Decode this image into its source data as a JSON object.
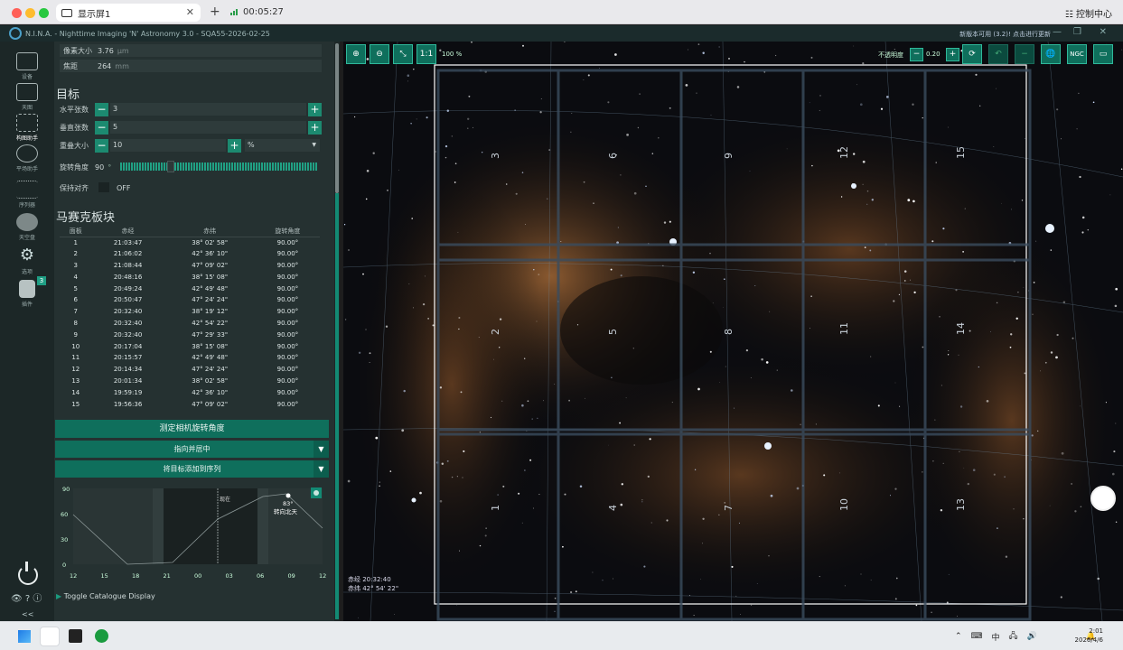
{
  "browser": {
    "tab_title": "显示屏1",
    "timer": "00:05:27",
    "control_center": "控制中心"
  },
  "app": {
    "title": "N.I.N.A. - Nighttime Imaging 'N' Astronomy 3.0  -  SQA55-2026-02-25",
    "update_notice": "新版本可用 (3.2)! 点击进行更新"
  },
  "nav": {
    "items": [
      {
        "label": "设备"
      },
      {
        "label": "天图"
      },
      {
        "label": "构图助手"
      },
      {
        "label": "平场助手"
      },
      {
        "label": "序列器"
      },
      {
        "label": "天空盘"
      },
      {
        "label": "选项"
      },
      {
        "label": "插件",
        "badge": "3"
      }
    ],
    "collapse": "<<"
  },
  "camera": {
    "pixel_size_label": "像素大小",
    "pixel_size_value": "3.76",
    "pixel_size_unit": "μm",
    "focal_label": "焦距",
    "focal_value": "264",
    "focal_unit": "mm"
  },
  "target": {
    "heading": "目标",
    "h_panels_label": "水平张数",
    "h_panels_value": "3",
    "v_panels_label": "垂直张数",
    "v_panels_value": "5",
    "overlap_label": "重叠大小",
    "overlap_value": "10",
    "overlap_unit": "%",
    "rotation_label": "旋转角度",
    "rotation_value": "90",
    "rotation_unit": "°",
    "keep_aligned_label": "保持对齐",
    "keep_aligned_state": "OFF"
  },
  "mosaic": {
    "heading": "马赛克板块",
    "columns": [
      "面板",
      "赤经",
      "赤纬",
      "旋转角度"
    ],
    "rows": [
      [
        "1",
        "21:03:47",
        "38° 02' 58\"",
        "90.00°"
      ],
      [
        "2",
        "21:06:02",
        "42° 36' 10\"",
        "90.00°"
      ],
      [
        "3",
        "21:08:44",
        "47° 09' 02\"",
        "90.00°"
      ],
      [
        "4",
        "20:48:16",
        "38° 15' 08\"",
        "90.00°"
      ],
      [
        "5",
        "20:49:24",
        "42° 49' 48\"",
        "90.00°"
      ],
      [
        "6",
        "20:50:47",
        "47° 24' 24\"",
        "90.00°"
      ],
      [
        "7",
        "20:32:40",
        "38° 19' 12\"",
        "90.00°"
      ],
      [
        "8",
        "20:32:40",
        "42° 54' 22\"",
        "90.00°"
      ],
      [
        "9",
        "20:32:40",
        "47° 29' 33\"",
        "90.00°"
      ],
      [
        "10",
        "20:17:04",
        "38° 15' 08\"",
        "90.00°"
      ],
      [
        "11",
        "20:15:57",
        "42° 49' 48\"",
        "90.00°"
      ],
      [
        "12",
        "20:14:34",
        "47° 24' 24\"",
        "90.00°"
      ],
      [
        "13",
        "20:01:34",
        "38° 02' 58\"",
        "90.00°"
      ],
      [
        "14",
        "19:59:19",
        "42° 36' 10\"",
        "90.00°"
      ],
      [
        "15",
        "19:56:36",
        "47° 09' 02\"",
        "90.00°"
      ]
    ]
  },
  "actions": {
    "measure_rotation": "测定相机旋转角度",
    "slew_center": "指向并居中",
    "add_to_sequence": "将目标添加到序列"
  },
  "altitude_chart": {
    "y_ticks": [
      "90",
      "60",
      "30",
      "0"
    ],
    "x_ticks": [
      "12",
      "15",
      "18",
      "21",
      "00",
      "03",
      "06",
      "09",
      "12"
    ],
    "now_label": "现在",
    "max_alt": "83°",
    "transit_label": "转向北天"
  },
  "catalogue": {
    "toggle_label": "Toggle Catalogue Display"
  },
  "viewer": {
    "zoom_level": "100 %",
    "opacity_label": "不透明度",
    "opacity_value": "0.20",
    "ngc_label": "NGC",
    "ra_readout": "赤经 20:32:40",
    "dec_readout": "赤纬 42° 54' 22\"",
    "panel_labels": [
      "1",
      "2",
      "3",
      "4",
      "5",
      "6",
      "7",
      "8",
      "9",
      "10",
      "11",
      "12",
      "13",
      "14",
      "15"
    ]
  },
  "taskbar": {
    "ime": "中",
    "time": "2:01",
    "date": "2026/4/6"
  }
}
